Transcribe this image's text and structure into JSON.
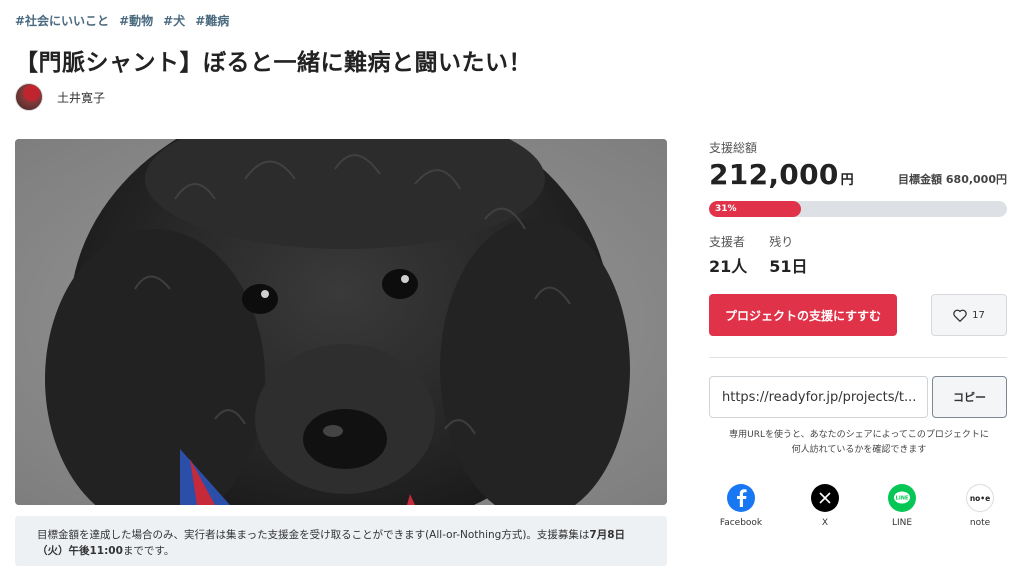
{
  "tags": [
    "#社会にいいこと",
    "#動物",
    "#犬",
    "#難病"
  ],
  "title": "【門脈シャント】ぼると一緒に難病と闘いたい！",
  "owner": {
    "name": "土井寛子"
  },
  "notice": {
    "text": "目標金額を達成した場合のみ、実行者は集まった支援金を受け取ることができます(All-or-Nothing方式)。支援募集は",
    "deadline": "7月8日（火）午後11:00",
    "tail": "までです。"
  },
  "funding": {
    "total_label": "支援総額",
    "amount": "212,000",
    "amount_unit": "円",
    "goal_label": "目標金額",
    "goal_value": "680,000円",
    "percent_label": "31%",
    "percent": 31,
    "supporters_label": "支援者",
    "supporters_value": "21人",
    "remaining_label": "残り",
    "remaining_value": "51日"
  },
  "actions": {
    "support_label": "プロジェクトの支援にすすむ",
    "favorite_count": "17"
  },
  "share_url": {
    "value": "https://readyfor.jp/projects/t...",
    "copy_label": "コピー",
    "note": "専用URLを使うと、あなたのシェアによってこのプロジェクトに何人訪れているかを確認できます"
  },
  "shares": [
    {
      "label": "Facebook",
      "icon": "facebook-icon",
      "color": "#1877f2"
    },
    {
      "label": "X",
      "icon": "x-icon",
      "color": "#000000"
    },
    {
      "label": "LINE",
      "icon": "line-icon",
      "color": "#06c755"
    },
    {
      "label": "note",
      "icon": "note-icon",
      "color": "#ffffff"
    }
  ],
  "colors": {
    "accent": "#e0334a",
    "tag": "#4a6a80"
  }
}
